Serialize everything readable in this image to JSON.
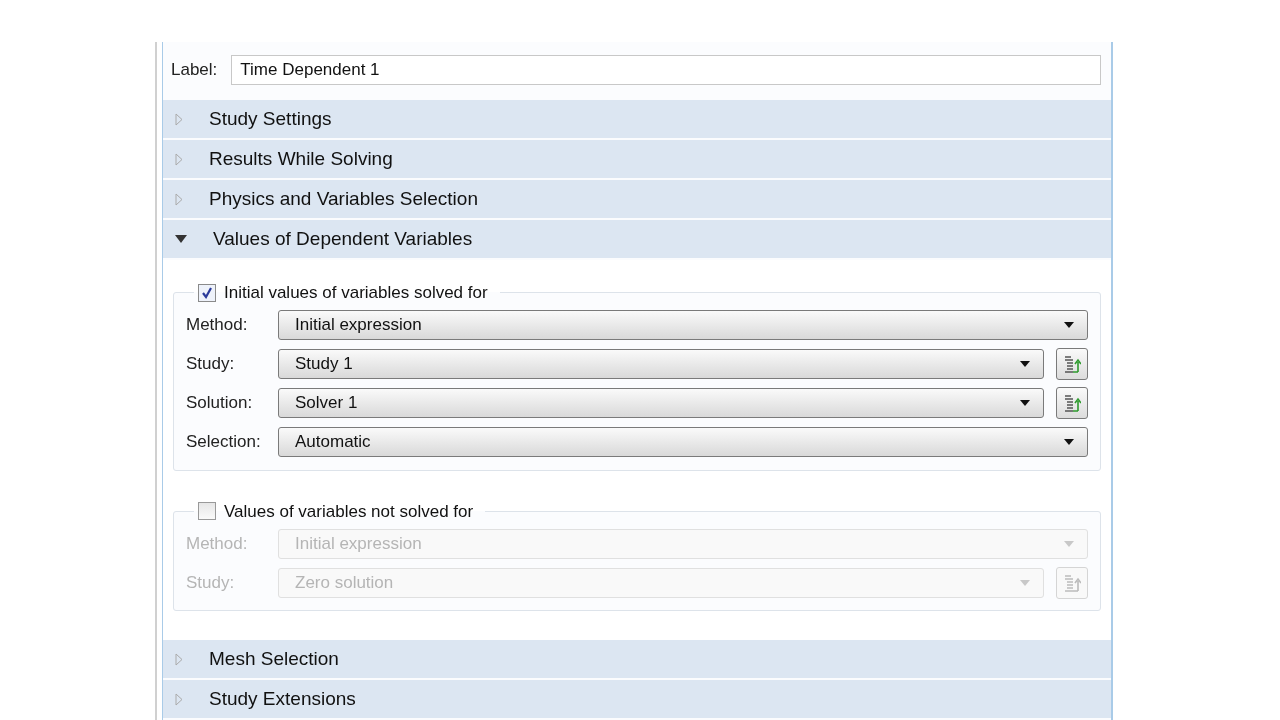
{
  "label_field": {
    "label": "Label:",
    "value": "Time Dependent 1"
  },
  "sections": [
    {
      "title": "Study Settings",
      "expanded": false
    },
    {
      "title": "Results While Solving",
      "expanded": false
    },
    {
      "title": "Physics and Variables Selection",
      "expanded": false
    },
    {
      "title": "Values of Dependent Variables",
      "expanded": true,
      "groups": [
        {
          "title": "Initial values of variables solved for",
          "checked": true,
          "rows": [
            {
              "label": "Method:",
              "value": "Initial expression",
              "kind": "combo"
            },
            {
              "label": "Study:",
              "value": "Study 1",
              "kind": "combo_button"
            },
            {
              "label": "Solution:",
              "value": "Solver 1",
              "kind": "combo_button"
            },
            {
              "label": "Selection:",
              "value": "Automatic",
              "kind": "combo"
            }
          ]
        },
        {
          "title": "Values of variables not solved for",
          "checked": false,
          "rows": [
            {
              "label": "Method:",
              "value": "Initial expression",
              "kind": "combo"
            },
            {
              "label": "Study:",
              "value": "Zero solution",
              "kind": "combo_button"
            }
          ]
        }
      ]
    },
    {
      "title": "Mesh Selection",
      "expanded": false
    },
    {
      "title": "Study Extensions",
      "expanded": false
    }
  ]
}
